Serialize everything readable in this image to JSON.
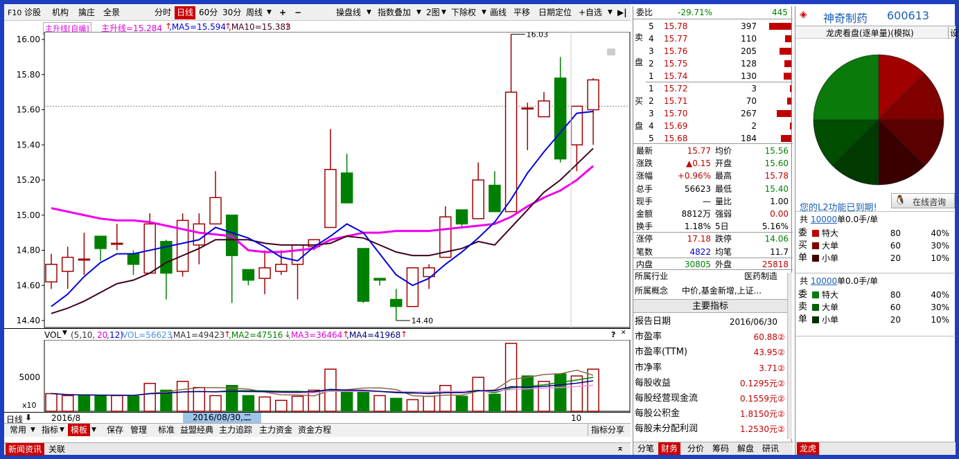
{
  "toolbar": {
    "f10": "F10",
    "diagnose": "诊股",
    "institution": "机构",
    "radar": "擒庄",
    "panorama": "全景",
    "timeshare": "分时",
    "daily": "日线",
    "m60": "60分",
    "m30": "30分",
    "weekly": "周线",
    "plus": "+",
    "minus": "−",
    "cross": "操盘线",
    "overlay": "指数叠加",
    "two_charts": "2图",
    "rights": "下除权",
    "draw": "画线",
    "pan": "平移",
    "date_locate": "日期定位",
    "watchlist": "+自选",
    "next": "▶|"
  },
  "indicator": {
    "name": "主升线[自编]",
    "main": "主升线=15.284",
    "ma5": ",MA5=15.594",
    "ma10": ",MA10=15.383"
  },
  "price_axis": [
    "16.00",
    "15.80",
    "15.60",
    "15.40",
    "15.20",
    "15.00",
    "14.80",
    "14.60",
    "14.40"
  ],
  "price_high_label": "16.03",
  "price_low_label": "14.40",
  "vol": {
    "label": "VOL",
    "params_prefix": "(5,10,",
    "param20": "20",
    "sep": ",",
    "param12": "12)",
    "vol": "VOL=56623",
    "ma1": ",MA1=49423",
    "ma2": ",MA2=47516",
    "ma3": ",MA3=36464",
    "ma4": ",MA4=41968",
    "axis_5000": "5000",
    "unit": "x10"
  },
  "xaxis": {
    "period": "日线",
    "start": "2016/8",
    "cursor": "2016/08/30,二",
    "mark": "10"
  },
  "bottom_tabs": [
    "常用",
    "指标",
    "模板",
    "保存",
    "管理",
    "标准",
    "益盟经典",
    "主力追踪",
    "主力资金",
    "资金方程"
  ],
  "bottom_right": "指标分享",
  "news_tabs": [
    "新闻资讯",
    "关联"
  ],
  "order_book": {
    "ratio_label": "委比",
    "ratio": "-29.71%",
    "ratio_diff": "445",
    "sell_label": [
      "卖",
      "盘"
    ],
    "buy_label": [
      "买",
      "盘"
    ],
    "sells": [
      {
        "lvl": "5",
        "price": "15.78",
        "vol": "397",
        "bar": 1.0
      },
      {
        "lvl": "4",
        "price": "15.77",
        "vol": "110",
        "bar": 0.28
      },
      {
        "lvl": "3",
        "price": "15.76",
        "vol": "205",
        "bar": 0.52
      },
      {
        "lvl": "2",
        "price": "15.75",
        "vol": "128",
        "bar": 0.32
      },
      {
        "lvl": "1",
        "price": "15.74",
        "vol": "130",
        "bar": 0.33
      }
    ],
    "buys": [
      {
        "lvl": "1",
        "price": "15.72",
        "vol": "3",
        "bar": 0.02
      },
      {
        "lvl": "2",
        "price": "15.71",
        "vol": "70",
        "bar": 0.18
      },
      {
        "lvl": "3",
        "price": "15.70",
        "vol": "267",
        "bar": 0.67
      },
      {
        "lvl": "4",
        "price": "15.69",
        "vol": "2",
        "bar": 0.01
      },
      {
        "lvl": "5",
        "price": "15.68",
        "vol": "184",
        "bar": 0.46
      }
    ]
  },
  "quote": [
    {
      "l1": "最新",
      "v1": "15.77",
      "c1": "red",
      "l2": "均价",
      "v2": "15.56",
      "c2": "green"
    },
    {
      "l1": "涨跌",
      "v1": "▲0.15",
      "c1": "red",
      "l2": "开盘",
      "v2": "15.60",
      "c2": "green"
    },
    {
      "l1": "涨幅",
      "v1": "+0.96%",
      "c1": "red",
      "l2": "最高",
      "v2": "15.78",
      "c2": "red"
    },
    {
      "l1": "总手",
      "v1": "56623",
      "c1": "black",
      "l2": "最低",
      "v2": "15.40",
      "c2": "green"
    },
    {
      "l1": "现手",
      "v1": "—",
      "c1": "black",
      "l2": "量比",
      "v2": "1.00",
      "c2": "black"
    },
    {
      "l1": "金额",
      "v1": "8812万",
      "c1": "black",
      "l2": "强弱",
      "v2": "0.00",
      "c2": "red"
    },
    {
      "l1": "换手",
      "v1": "1.18%",
      "c1": "black",
      "l2": "5日",
      "v2": "5.16%",
      "c2": "black"
    },
    {
      "l1": "涨停",
      "v1": "17.18",
      "c1": "red",
      "l2": "跌停",
      "v2": "14.06",
      "c2": "green"
    },
    {
      "l1": "笔数",
      "v1": "4822",
      "c1": "blue",
      "l2": "均笔",
      "v2": "11.7",
      "c2": "black"
    },
    {
      "l1": "内盘",
      "v1": "30805",
      "c1": "green",
      "l2": "外盘",
      "v2": "25818",
      "c2": "red"
    }
  ],
  "industry": {
    "label": "所属行业",
    "value": "医药制造"
  },
  "concept": {
    "label": "所属概念",
    "value": "中价,基金新增,上证..."
  },
  "metrics_title": "主要指标",
  "metrics": [
    {
      "k": "报告日期",
      "v": "2016/06/30",
      "suf": ""
    },
    {
      "k": "市盈率",
      "v": "60.88",
      "suf": "②"
    },
    {
      "k": "市盈率(TTM)",
      "v": "43.95",
      "suf": "②"
    },
    {
      "k": "市净率",
      "v": "3.71",
      "suf": "②"
    },
    {
      "k": "每股收益",
      "v": "0.1295元",
      "suf": "②"
    },
    {
      "k": "每股经营现金流",
      "v": "0.1559元",
      "suf": "②"
    },
    {
      "k": "每股公积金",
      "v": "1.8150元",
      "suf": "②"
    },
    {
      "k": "每股未分配利润",
      "v": "1.2530元",
      "suf": "②"
    }
  ],
  "rp_tabs": [
    "分笔",
    "财务",
    "分价",
    "筹码",
    "解盘",
    "研讯"
  ],
  "stock": {
    "name": "神奇制药",
    "code": "600613"
  },
  "lhb": {
    "title": "龙虎看盘(逐单量)(模拟)",
    "side": "设"
  },
  "pie": {
    "slices": [
      {
        "value": 12.5,
        "color": "#a00000"
      },
      {
        "value": 12.5,
        "color": "#800000"
      },
      {
        "value": 12.5,
        "color": "#5a0000"
      },
      {
        "value": 12.5,
        "color": "#3a0000"
      },
      {
        "value": 12.5,
        "color": "#003a00"
      },
      {
        "value": 12.5,
        "color": "#004d00"
      },
      {
        "value": 25,
        "color": "#0a7a0a"
      }
    ]
  },
  "l2_notice": "您的L2功能已到期!",
  "consult": "在线咨询",
  "buy_section": {
    "header_pre": "共",
    "header_num": "10000",
    "header_post": "单0.0手/单",
    "side": [
      "委",
      "买",
      "单"
    ],
    "rows": [
      {
        "n": "特大",
        "a": "80",
        "p": "40%",
        "color": "#c00000"
      },
      {
        "n": "大单",
        "a": "60",
        "p": "30%",
        "color": "#800000"
      },
      {
        "n": "小单",
        "a": "20",
        "p": "10%",
        "color": "#400000"
      }
    ]
  },
  "sell_section": {
    "header_pre": "共",
    "header_num": "10000",
    "header_post": "单0.0手/单",
    "side": [
      "委",
      "卖",
      "单"
    ],
    "rows": [
      {
        "n": "特大",
        "a": "80",
        "p": "40%",
        "color": "#0a7a0a"
      },
      {
        "n": "大单",
        "a": "60",
        "p": "30%",
        "color": "#006000"
      },
      {
        "n": "小单",
        "a": "20",
        "p": "10%",
        "color": "#003000"
      }
    ]
  },
  "fr_tab": "龙虎",
  "chart_data": {
    "type": "candlestick",
    "ylim": [
      14.4,
      16.03
    ],
    "candles": [
      {
        "o": 14.62,
        "c": 14.72,
        "h": 14.78,
        "l": 14.58
      },
      {
        "o": 14.68,
        "c": 14.76,
        "h": 14.82,
        "l": 14.58
      },
      {
        "o": 14.75,
        "c": 14.75,
        "h": 14.9,
        "l": 14.66
      },
      {
        "o": 14.88,
        "c": 14.81,
        "h": 14.88,
        "l": 14.74
      },
      {
        "o": 14.84,
        "c": 14.84,
        "h": 14.95,
        "l": 14.8
      },
      {
        "o": 14.78,
        "c": 14.72,
        "h": 14.8,
        "l": 14.66
      },
      {
        "o": 14.67,
        "c": 14.95,
        "h": 15.01,
        "l": 14.67
      },
      {
        "o": 14.85,
        "c": 14.67,
        "h": 14.86,
        "l": 14.52
      },
      {
        "o": 14.68,
        "c": 14.97,
        "h": 15.01,
        "l": 14.65
      },
      {
        "o": 14.83,
        "c": 14.95,
        "h": 15.01,
        "l": 14.72
      },
      {
        "o": 14.95,
        "c": 15.1,
        "h": 15.25,
        "l": 14.95
      },
      {
        "o": 15.0,
        "c": 14.77,
        "h": 15.0,
        "l": 14.5
      },
      {
        "o": 14.69,
        "c": 14.63,
        "h": 14.69,
        "l": 14.6
      },
      {
        "o": 14.64,
        "c": 14.7,
        "h": 14.8,
        "l": 14.55
      },
      {
        "o": 14.68,
        "c": 14.72,
        "h": 14.8,
        "l": 14.66
      },
      {
        "o": 14.72,
        "c": 14.83,
        "h": 14.83,
        "l": 14.52
      },
      {
        "o": 14.82,
        "c": 14.86,
        "h": 14.86,
        "l": 14.8
      },
      {
        "o": 14.93,
        "c": 15.26,
        "h": 15.49,
        "l": 14.93
      },
      {
        "o": 15.24,
        "c": 15.07,
        "h": 15.35,
        "l": 15.07
      },
      {
        "o": 14.81,
        "c": 14.51,
        "h": 14.81,
        "l": 14.5
      },
      {
        "o": 14.64,
        "c": 14.63,
        "h": 14.64,
        "l": 14.6
      },
      {
        "o": 14.52,
        "c": 14.48,
        "h": 14.58,
        "l": 14.4
      },
      {
        "o": 14.48,
        "c": 14.7,
        "h": 14.7,
        "l": 14.48
      },
      {
        "o": 14.65,
        "c": 14.7,
        "h": 14.72,
        "l": 14.58
      },
      {
        "o": 14.76,
        "c": 14.99,
        "h": 15.05,
        "l": 14.76
      },
      {
        "o": 15.03,
        "c": 14.95,
        "h": 15.03,
        "l": 14.93
      },
      {
        "o": 14.98,
        "c": 15.2,
        "h": 15.3,
        "l": 14.98
      },
      {
        "o": 15.17,
        "c": 15.02,
        "h": 15.25,
        "l": 15.02
      },
      {
        "o": 15.02,
        "c": 15.7,
        "h": 16.03,
        "l": 15.02
      },
      {
        "o": 15.61,
        "c": 15.61,
        "h": 15.64,
        "l": 15.37
      },
      {
        "o": 15.56,
        "c": 15.65,
        "h": 15.7,
        "l": 15.56
      },
      {
        "o": 15.78,
        "c": 15.32,
        "h": 15.9,
        "l": 15.3
      },
      {
        "o": 15.4,
        "c": 15.62,
        "h": 15.62,
        "l": 15.25
      },
      {
        "o": 15.6,
        "c": 15.77,
        "h": 15.78,
        "l": 15.4
      }
    ],
    "main_line": [
      15.04,
      15.02,
      15.0,
      14.98,
      14.97,
      14.97,
      14.96,
      14.94,
      14.92,
      14.9,
      14.89,
      14.88,
      14.8,
      14.79,
      14.79,
      14.8,
      14.81,
      14.86,
      14.88,
      14.9,
      14.9,
      14.91,
      14.91,
      14.91,
      14.92,
      14.93,
      14.94,
      14.95,
      14.99,
      15.05,
      15.1,
      15.14,
      15.2,
      15.28
    ],
    "ma5": [
      14.48,
      14.55,
      14.65,
      14.73,
      14.78,
      14.78,
      14.8,
      14.82,
      14.84,
      14.86,
      14.93,
      14.9,
      14.87,
      14.82,
      14.76,
      14.74,
      14.82,
      14.88,
      14.95,
      14.9,
      14.78,
      14.66,
      14.6,
      14.64,
      14.72,
      14.79,
      14.87,
      14.96,
      15.09,
      15.24,
      15.36,
      15.47,
      15.58,
      15.59
    ],
    "ma10": [
      14.44,
      14.47,
      14.51,
      14.56,
      14.61,
      14.63,
      14.67,
      14.73,
      14.77,
      14.81,
      14.86,
      14.86,
      14.86,
      14.84,
      14.83,
      14.83,
      14.83,
      14.84,
      14.88,
      14.87,
      14.83,
      14.79,
      14.77,
      14.77,
      14.79,
      14.81,
      14.85,
      14.83,
      14.93,
      15.03,
      15.13,
      15.2,
      15.29,
      15.38
    ],
    "volume": [
      2.6,
      2.3,
      2.3,
      2.3,
      2.3,
      2.2,
      4.1,
      3.1,
      4.4,
      3.5,
      2.3,
      3.8,
      2.3,
      2.1,
      1.6,
      2.2,
      3.1,
      6.2,
      2.8,
      2.8,
      2.3,
      1.9,
      1.7,
      2.2,
      3.8,
      2.2,
      5.0,
      2.5,
      10.0,
      5.2,
      4.4,
      5.5,
      5.2,
      6.2
    ],
    "vol_up": [
      true,
      true,
      false,
      false,
      true,
      false,
      true,
      false,
      true,
      true,
      true,
      false,
      false,
      true,
      true,
      true,
      true,
      true,
      false,
      false,
      true,
      false,
      true,
      true,
      true,
      false,
      true,
      false,
      true,
      false,
      true,
      false,
      true,
      true
    ]
  }
}
